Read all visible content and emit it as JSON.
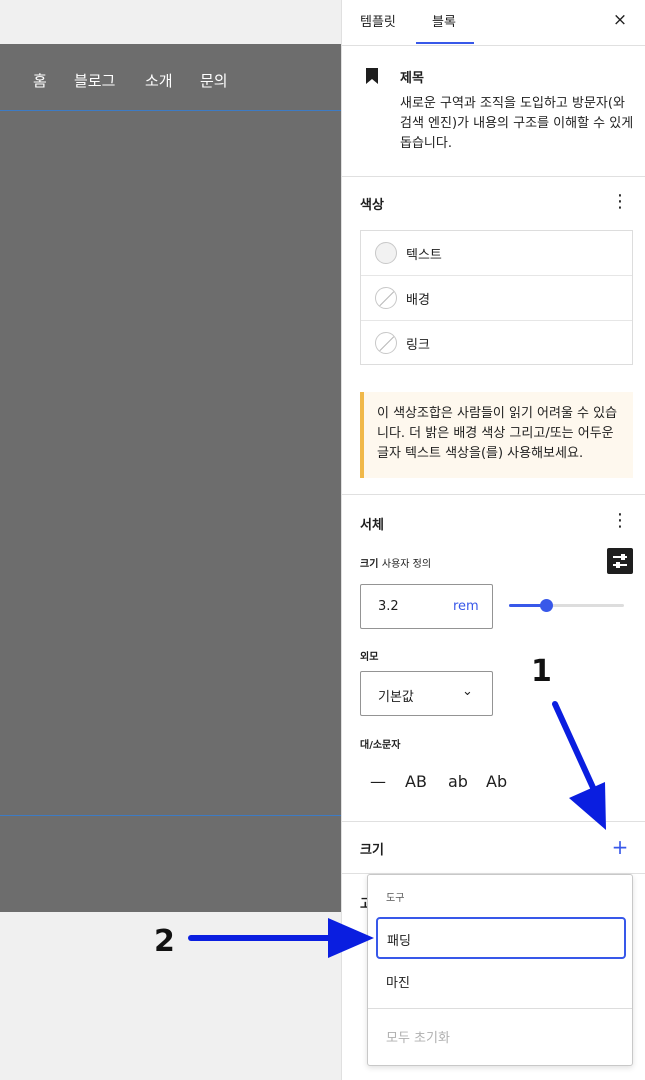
{
  "canvas": {
    "nav": [
      "홈",
      "블로그",
      "소개",
      "문의"
    ]
  },
  "sidebar": {
    "tabs": [
      {
        "label": "템플릿"
      },
      {
        "label": "블록"
      }
    ],
    "close_label": "×",
    "block": {
      "title": "제목",
      "description": "새로운 구역과 조직을 도입하고 방문자(와 검색 엔진)가 내용의 구조를 이해할 수 있게 돕습니다."
    },
    "color": {
      "title": "색상",
      "items": [
        {
          "label": "텍스트"
        },
        {
          "label": "배경"
        },
        {
          "label": "링크"
        }
      ],
      "notice": "이 색상조합은 사람들이 읽기 어려울 수 있습니다. 더 밝은 배경 색상 그리고/또는 어두운 글자 텍스트 색상을(를) 사용해보세요."
    },
    "typography": {
      "title": "서체",
      "size_label": "크기",
      "size_custom": "사용자 정의",
      "size_value": "3.2",
      "size_unit": "rem",
      "slider_fraction": 0.32,
      "appearance_label": "외모",
      "appearance_value": "기본값",
      "case_label": "대/소문자",
      "case_options": [
        "—",
        "AB",
        "ab",
        "Ab"
      ]
    },
    "dimensions": {
      "title": "크기",
      "add_label": "+"
    },
    "hidden_panel_label": "고"
  },
  "menu": {
    "group_label": "도구",
    "items": [
      {
        "label": "패딩"
      },
      {
        "label": "마진"
      }
    ],
    "reset_label": "모두 초기화"
  },
  "annotations": {
    "first": "1",
    "second": "2"
  },
  "colors": {
    "accent": "#3858e9",
    "arrow": "#0a1ee0",
    "notice_border": "#f0b849",
    "canvas_dark": "#6d6d6d"
  }
}
